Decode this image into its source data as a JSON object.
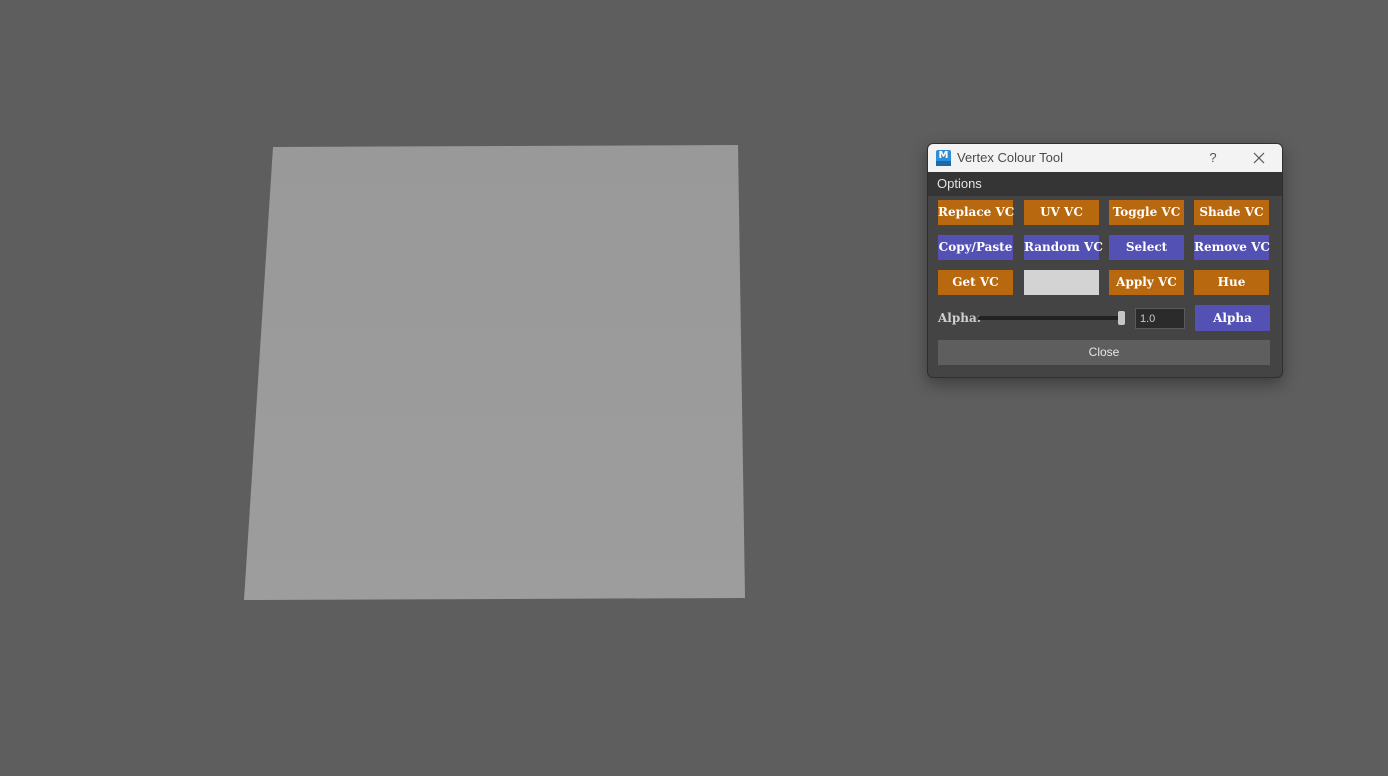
{
  "viewport": {
    "background": "#5e5e5e",
    "plane_color": "#9b9b9b"
  },
  "dialog": {
    "title": "Vertex Colour Tool",
    "app_icon": "maya-logo-icon",
    "help_label": "?",
    "close_icon": "close-icon",
    "menu": [
      "Options"
    ],
    "rows": [
      [
        {
          "label": "Replace VC",
          "color": "orange"
        },
        {
          "label": "UV VC",
          "color": "orange"
        },
        {
          "label": "Toggle VC",
          "color": "orange"
        },
        {
          "label": "Shade VC",
          "color": "orange"
        }
      ],
      [
        {
          "label": "Copy/Paste",
          "color": "purple"
        },
        {
          "label": "Random VC",
          "color": "purple"
        },
        {
          "label": "Select",
          "color": "purple"
        },
        {
          "label": "Remove VC",
          "color": "purple"
        }
      ],
      [
        {
          "label": "Get VC",
          "color": "orange"
        },
        {
          "label": "",
          "color": "swatch"
        },
        {
          "label": "Apply VC",
          "color": "orange"
        },
        {
          "label": "Hue",
          "color": "orange"
        }
      ]
    ],
    "swatch_color": "#d3d3d3",
    "alpha": {
      "label": "Alpha:",
      "value": "1.0",
      "slider_fraction": 1.0,
      "button_label": "Alpha"
    },
    "close_label": "Close",
    "colors": {
      "orange": "#b8690f",
      "purple": "#5351b3"
    }
  }
}
